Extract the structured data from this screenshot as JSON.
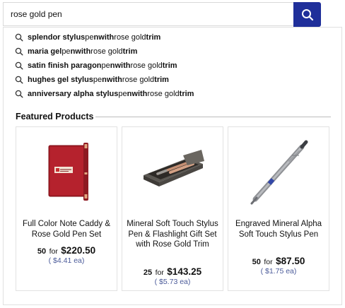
{
  "search": {
    "value": "rose gold pen",
    "button_icon": "search-icon",
    "accent_color": "#1f2f9a"
  },
  "suggestions": [
    {
      "bold_prefix": "splendor stylus",
      "mid1": " pe",
      "n_bold": "n",
      "mid2": " ",
      "with": "with",
      "rest": " rose gold ",
      "trim": "trim"
    },
    {
      "bold_prefix": "maria gel",
      "mid1": " pe",
      "n_bold": "n",
      "mid2": " ",
      "with": "with",
      "rest": " rose gold ",
      "trim": "trim"
    },
    {
      "bold_prefix": "satin finish paragon",
      "mid1": " pe",
      "n_bold": "n",
      "mid2": " ",
      "with": "with",
      "rest": " rose gold ",
      "trim": "trim"
    },
    {
      "bold_prefix": "hughes gel stylus",
      "mid1": " pe",
      "n_bold": "n",
      "mid2": " ",
      "with": "with",
      "rest": " rose gold ",
      "trim": "trim"
    },
    {
      "bold_prefix": "anniversary alpha stylus",
      "mid1": " pe",
      "n_bold": "n",
      "mid2": " ",
      "with": "with",
      "rest": " rose gold ",
      "trim": "trim"
    }
  ],
  "featured": {
    "heading": "Featured Products",
    "products": [
      {
        "name": "Full Color Note Caddy & Rose Gold Pen Set",
        "qty": "50",
        "for": "for",
        "price": "$220.50",
        "each": "( $4.41 ea)"
      },
      {
        "name": "Mineral Soft Touch Stylus Pen & Flashlight Gift Set with Rose Gold Trim",
        "qty": "25",
        "for": "for",
        "price": "$143.25",
        "each": "( $5.73 ea)"
      },
      {
        "name": "Engraved Mineral Alpha Soft Touch Stylus Pen",
        "qty": "50",
        "for": "for",
        "price": "$87.50",
        "each": "( $1.75 ea)"
      }
    ]
  }
}
